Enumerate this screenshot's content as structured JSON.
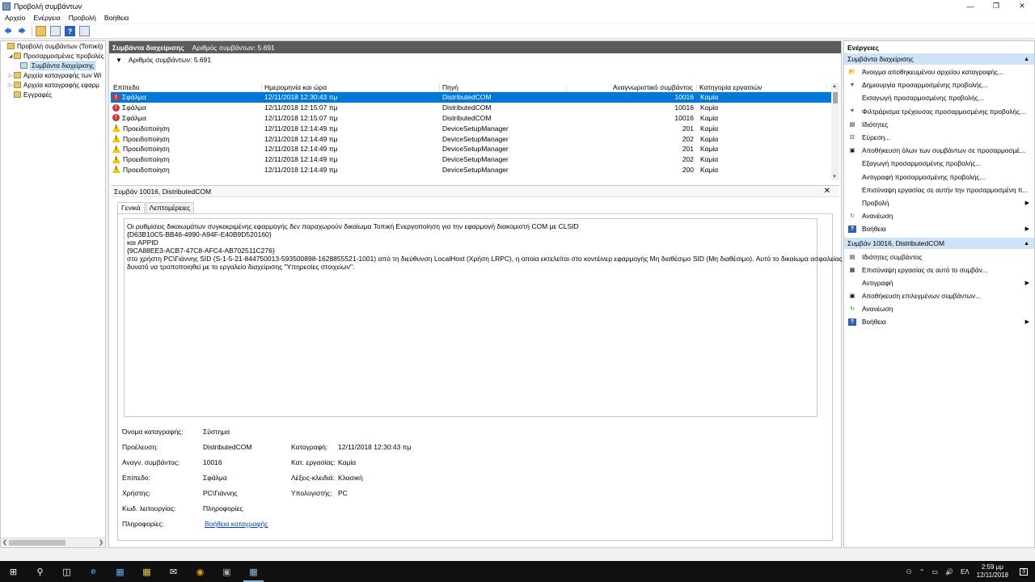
{
  "window": {
    "title": "Προβολή συμβάντων"
  },
  "menu": [
    "Αρχείο",
    "Ενέργεια",
    "Προβολή",
    "Βοήθεια"
  ],
  "tree": [
    {
      "label": "Προβολή συμβάντων (Τοπική)",
      "indent": 0,
      "expander": ""
    },
    {
      "label": "Προσαρμοσμένες προβολές",
      "indent": 1,
      "expander": "◢"
    },
    {
      "label": "Συμβάντα διαχείρισης",
      "indent": 2,
      "expander": "",
      "selected": true
    },
    {
      "label": "Αρχεία καταγραφής των Wi",
      "indent": 1,
      "expander": "▷"
    },
    {
      "label": "Αρχεία καταγραφής εφαρμ",
      "indent": 1,
      "expander": "▷"
    },
    {
      "label": "Εγγραφές",
      "indent": 1,
      "expander": ""
    }
  ],
  "center": {
    "header_title": "Συμβάντα διαχείρισης",
    "header_count": "Αριθμός συμβάντων: 5.691",
    "filter_count": "Αριθμός συμβάντων: 5.691",
    "columns": [
      "Επίπεδο",
      "Ημερομηνία και ώρα",
      "Πηγή",
      "Αναγνωριστικό συμβάντος",
      "Κατηγορία εργασιών"
    ],
    "rows": [
      {
        "level": "Σφάλμα",
        "type": "error",
        "date": "12/11/2018 12:30:43 πμ",
        "source": "DistributedCOM",
        "id": "10016",
        "category": "Καμία"
      },
      {
        "level": "Σφάλμα",
        "type": "error",
        "date": "12/11/2018 12:15:07 πμ",
        "source": "DistributedCOM",
        "id": "10016",
        "category": "Καμία"
      },
      {
        "level": "Σφάλμα",
        "type": "error",
        "date": "12/11/2018 12:15:07 πμ",
        "source": "DistributedCOM",
        "id": "10016",
        "category": "Καμία"
      },
      {
        "level": "Προειδοποίηση",
        "type": "warn",
        "date": "12/11/2018 12:14:49 πμ",
        "source": "DeviceSetupManager",
        "id": "201",
        "category": "Καμία"
      },
      {
        "level": "Προειδοποίηση",
        "type": "warn",
        "date": "12/11/2018 12:14:49 πμ",
        "source": "DeviceSetupManager",
        "id": "202",
        "category": "Καμία"
      },
      {
        "level": "Προειδοποίηση",
        "type": "warn",
        "date": "12/11/2018 12:14:49 πμ",
        "source": "DeviceSetupManager",
        "id": "201",
        "category": "Καμία"
      },
      {
        "level": "Προειδοποίηση",
        "type": "warn",
        "date": "12/11/2018 12:14:49 πμ",
        "source": "DeviceSetupManager",
        "id": "202",
        "category": "Καμία"
      },
      {
        "level": "Προειδοποίηση",
        "type": "warn",
        "date": "12/11/2018 12:14:49 πμ",
        "source": "DeviceSetupManager",
        "id": "200",
        "category": "Καμία"
      }
    ]
  },
  "detail": {
    "title": "Συμβάν 10016, DistributedCOM",
    "tabs": [
      "Γενικά",
      "Λεπτομέρειες"
    ],
    "message_lines": [
      "Οι ρυθμίσεις δικαιωμάτων συγκεκριμένης εφαρμογής δεν παραχωρούν δικαίωμα Τοπική Ενεργοποίηση για την εφαρμογή διακομιστή COM με CLSID",
      "{D63B10C5-BB46-4990-A94F-E40B9D520160}",
      " και APPID",
      "{9CA88EE3-ACB7-47C8-AFC4-AB702511C276}",
      " στο χρήστη PC\\Γιάννης SID (S-1-5-21-844750013-593500898-1628855521-1001) από τη διεύθυνση LocalHost (Χρήση LRPC), η οποία εκτελείται στο κοντέινερ εφαρμογής Μη διαθέσιμο SID (Μη διαθέσιμο). Αυτό το δικαίωμα ασφαλείας είναι",
      "δυνατό να τροποποιηθεί με το εργαλείο διαχείρισης \"Υπηρεσίες στοιχείων\"."
    ],
    "props": {
      "log_name_label": "Όνομα καταγραφής:",
      "log_name": "Σύστημα",
      "source_label": "Προέλευση:",
      "source": "DistributedCOM",
      "logged_label": "Καταγραφή:",
      "logged": "12/11/2018 12:30:43 πμ",
      "event_id_label": "Αναγν. συμβάντος:",
      "event_id": "10016",
      "task_label": "Κατ. εργασίας:",
      "task": "Καμία",
      "level_label": "Επίπεδο:",
      "level": "Σφάλμα",
      "keywords_label": "Λέξεις-κλειδιά:",
      "keywords": "Κλασική",
      "user_label": "Χρήστης:",
      "user": "PC\\Γιάννης",
      "computer_label": "Υπολογιστής:",
      "computer": "PC",
      "opcode_label": "Κωδ. λειτουργίας:",
      "opcode": "Πληροφορίες",
      "info_label": "Πληροφορίες:",
      "info_link": "Βοήθεια καταγραφής"
    }
  },
  "actions": {
    "title": "Ενέργειες",
    "section1": "Συμβάντα διαχείρισης",
    "items1": [
      {
        "label": "Άνοιγμα αποθηκευμένου αρχείου καταγραφής...",
        "icon": "folder-open-icon",
        "glyph": "📂",
        "sub": false
      },
      {
        "label": "Δημιουργία προσαρμοσμένης προβολής...",
        "icon": "filter-icon",
        "glyph": "▼",
        "sub": false
      },
      {
        "label": "Εισαγωγή προσαρμοσμένης προβολής...",
        "icon": "",
        "glyph": "",
        "sub": false
      },
      {
        "label": "Φιλτράρισμα τρέχουσας προσαρμοσμένης προβολής...",
        "icon": "filter-icon",
        "glyph": "▼",
        "sub": false
      },
      {
        "label": "Ιδιότητες",
        "icon": "properties-icon",
        "glyph": "▤",
        "sub": false
      },
      {
        "label": "Εύρεση...",
        "icon": "find-icon",
        "glyph": "☷",
        "sub": false
      },
      {
        "label": "Αποθήκευση όλων των συμβάντων σε προσαρμοσμέ...",
        "icon": "save-icon",
        "glyph": "▣",
        "sub": false
      },
      {
        "label": "Εξαγωγή προσαρμοσμένης προβολής...",
        "icon": "",
        "glyph": "",
        "sub": false
      },
      {
        "label": "Αντιγραφή προσαρμοσμένης προβολής...",
        "icon": "",
        "glyph": "",
        "sub": false
      },
      {
        "label": "Επισύναψη εργασίας σε αυτήν την προσαρμοσμένη π...",
        "icon": "",
        "glyph": "",
        "sub": false
      },
      {
        "label": "Προβολή",
        "icon": "",
        "glyph": "",
        "sub": true
      },
      {
        "label": "Ανανέωση",
        "icon": "refresh-icon",
        "glyph": "↻",
        "sub": false
      },
      {
        "label": "Βοήθεια",
        "icon": "help-icon",
        "glyph": "?",
        "sub": true
      }
    ],
    "section2": "Συμβάν 10016, DistributedCOM",
    "items2": [
      {
        "label": "Ιδιότητες συμβάντος",
        "icon": "properties-icon",
        "glyph": "▤",
        "sub": false
      },
      {
        "label": "Επισύναψη εργασίας σε αυτό το συμβάν...",
        "icon": "task-icon",
        "glyph": "▦",
        "sub": false
      },
      {
        "label": "Αντιγραφή",
        "icon": "",
        "glyph": "",
        "sub": true
      },
      {
        "label": "Αποθήκευση επιλεγμένων συμβάντων...",
        "icon": "save-icon",
        "glyph": "▣",
        "sub": false
      },
      {
        "label": "Ανανέωση",
        "icon": "refresh-icon",
        "glyph": "↻",
        "sub": false
      },
      {
        "label": "Βοήθεια",
        "icon": "help-icon",
        "glyph": "?",
        "sub": true
      }
    ]
  },
  "taskbar": {
    "lang": "ΕΛ",
    "time": "2:59 μμ",
    "date": "12/11/2018",
    "notif_count": "3"
  },
  "colors": {
    "selection": "#0078d7",
    "header": "#5b5b5b",
    "section": "#cfe3f7",
    "error": "#d13438",
    "warning": "#f2c600"
  }
}
